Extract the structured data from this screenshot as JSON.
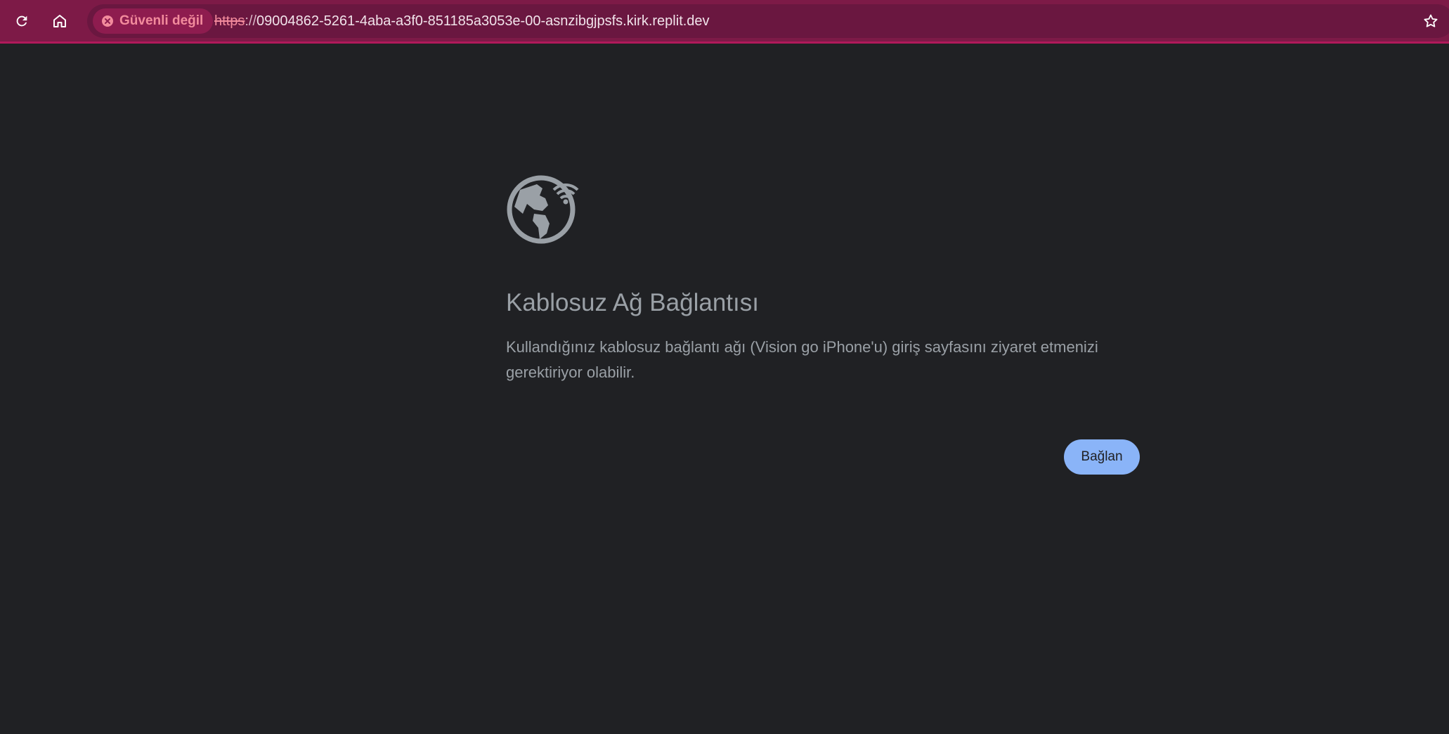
{
  "browser": {
    "security_label": "Güvenli değil",
    "url_scheme": "https",
    "url_separator": "://",
    "url_host": "09004862-5261-4aba-a3f0-851185a3053e-00-asnzibgjpsfs.kirk.replit.dev",
    "icons": {
      "reload": "reload-icon",
      "home": "home-icon",
      "security": "not-secure-icon",
      "bookmark": "star-icon"
    },
    "colors": {
      "toolbar": "#7d1a47",
      "omnibox": "#6a1740",
      "warning": "#f28b9c"
    }
  },
  "page": {
    "icon": "wifi-globe-icon",
    "title": "Kablosuz Ağ Bağlantısı",
    "message": "Kullandığınız kablosuz bağlantı ağı (Vision go iPhone'u) giriş sayfasını ziyaret etmenizi gerektiriyor olabilir.",
    "connect_label": "Bağlan",
    "colors": {
      "background": "#202124",
      "text": "#9aa0a6",
      "button": "#8ab4f8"
    }
  }
}
